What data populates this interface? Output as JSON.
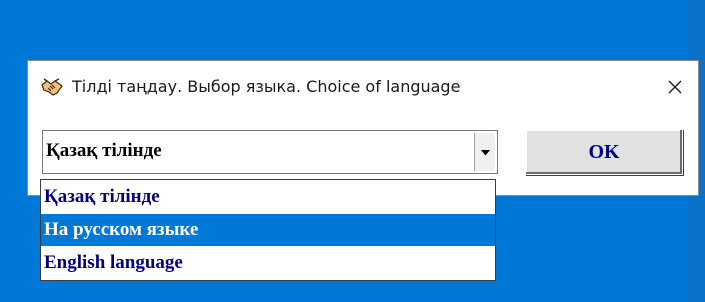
{
  "dialog": {
    "title": "Тілді таңдау. Выбор языка. Choice of language",
    "app_icon": "handshake-icon",
    "close_icon": "close-icon"
  },
  "language_select": {
    "value": "Қазақ тілінде",
    "arrow_icon": "dropdown-arrow-icon"
  },
  "ok_button": {
    "label": "OK"
  },
  "dropdown": {
    "options": [
      "Қазақ тілінде",
      "На русском языке",
      "English language"
    ],
    "highlighted_index": 1
  },
  "colors": {
    "desktop": "#0078d7",
    "highlight": "#0078d7",
    "option_text": "#000080"
  }
}
